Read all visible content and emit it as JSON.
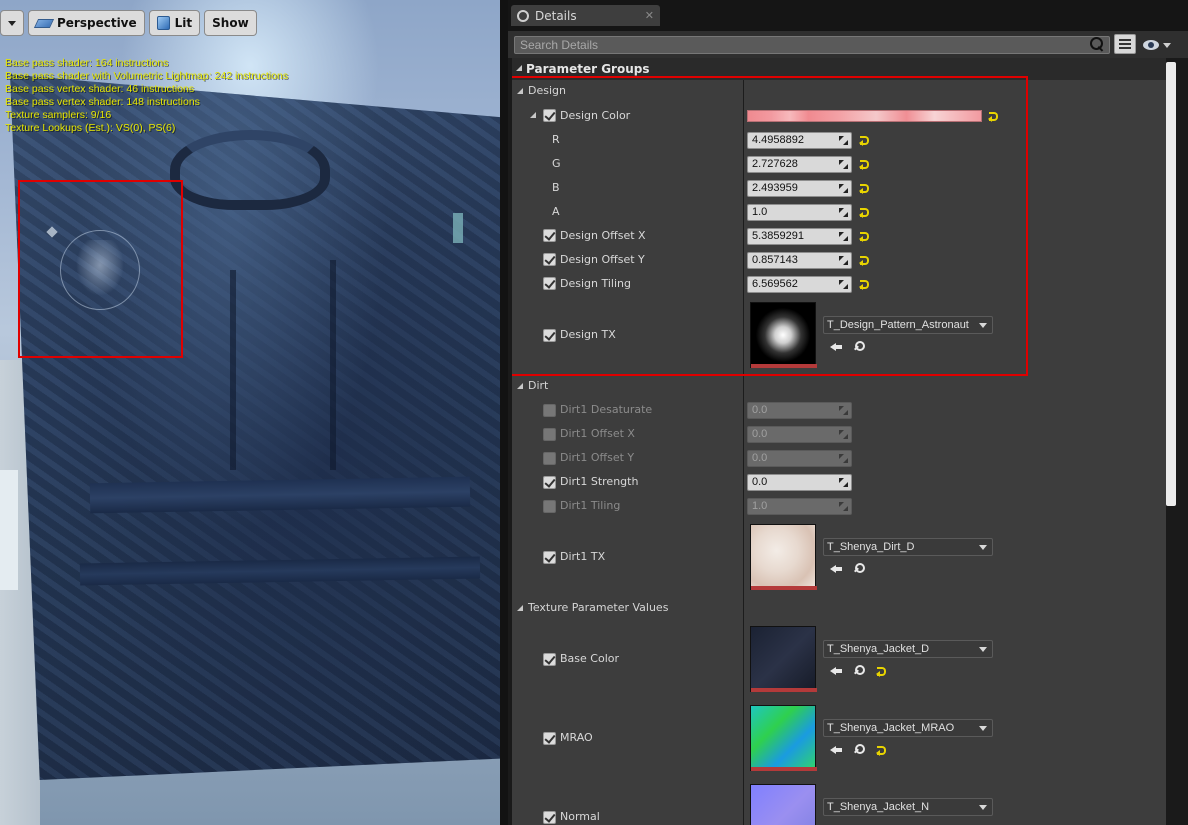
{
  "viewport": {
    "dropdown_label": "",
    "perspective_label": "Perspective",
    "lit_label": "Lit",
    "show_label": "Show",
    "stats": [
      "Base pass shader: 164 instructions",
      "Base pass shader with Volumetric Lightmap: 242 instructions",
      "Base pass vertex shader: 46 instructions",
      "Base pass vertex shader: 148 instructions",
      "Texture samplers: 9/16",
      "Texture Lookups (Est.): VS(0), PS(6)"
    ]
  },
  "details": {
    "tab_label": "Details",
    "tab_close": "✕",
    "search_placeholder": "Search Details",
    "section_title": "Parameter Groups",
    "groups": {
      "design": {
        "label": "Design",
        "color_param": {
          "label": "Design Color",
          "checked": true,
          "color": "#f08a90"
        },
        "channels": [
          {
            "label": "R",
            "value": "4.4958892"
          },
          {
            "label": "G",
            "value": "2.727628"
          },
          {
            "label": "B",
            "value": "2.493959"
          },
          {
            "label": "A",
            "value": "1.0"
          }
        ],
        "params": [
          {
            "label": "Design Offset X",
            "value": "5.3859291",
            "checked": true
          },
          {
            "label": "Design Offset Y",
            "value": "0.857143",
            "checked": true
          },
          {
            "label": "Design Tiling",
            "value": "6.569562",
            "checked": true
          }
        ],
        "texture": {
          "label": "Design TX",
          "asset": "T_Design_Pattern_Astronaut",
          "checked": true
        }
      },
      "dirt": {
        "label": "Dirt",
        "params": [
          {
            "label": "Dirt1 Desaturate",
            "value": "0.0",
            "checked": false
          },
          {
            "label": "Dirt1 Offset X",
            "value": "0.0",
            "checked": false
          },
          {
            "label": "Dirt1 Offset Y",
            "value": "0.0",
            "checked": false
          },
          {
            "label": "Dirt1 Strength",
            "value": "0.0",
            "checked": true
          },
          {
            "label": "Dirt1 Tiling",
            "value": "1.0",
            "checked": false
          }
        ],
        "texture": {
          "label": "Dirt1 TX",
          "asset": "T_Shenya_Dirt_D",
          "checked": true
        }
      },
      "texture_params": {
        "label": "Texture Parameter Values",
        "items": [
          {
            "label": "Base Color",
            "asset": "T_Shenya_Jacket_D",
            "checked": true
          },
          {
            "label": "MRAO",
            "asset": "T_Shenya_Jacket_MRAO",
            "checked": true
          },
          {
            "label": "Normal",
            "asset": "T_Shenya_Jacket_N",
            "checked": true
          }
        ]
      }
    }
  },
  "colors": {
    "highlight": "#e00000",
    "reset_arrow": "#e8d400",
    "stats_text": "#e6e600"
  }
}
